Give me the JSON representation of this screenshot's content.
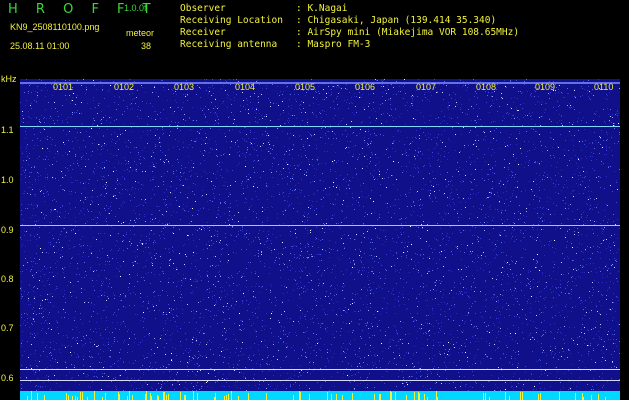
{
  "header": {
    "app_title": "H R O F F T",
    "version": "1.0.0f",
    "filename": "KN9_2508110100.png",
    "datetime": "25.08.11 01:00",
    "meteor_label": "meteor",
    "meteor_count": "38"
  },
  "info": {
    "rows": [
      {
        "label": "Observer",
        "value": ": K.Nagai"
      },
      {
        "label": "Receiving Location",
        "value": ": Chigasaki, Japan (139.414 35.340)"
      },
      {
        "label": "Receiver",
        "value": ": AirSpy mini (Miakejima VOR 108.65MHz)"
      },
      {
        "label": "Receiving antenna",
        "value": ": Maspro FM-3"
      }
    ]
  },
  "spectrogram": {
    "unit": "kHz",
    "y_ticks": [
      "1.1",
      "1.0",
      "0.9",
      "0.8",
      "0.7",
      "0.6"
    ],
    "x_ticks": [
      "0101",
      "0102",
      "0103",
      "0104",
      "0105",
      "0106",
      "0107",
      "0108",
      "0109",
      "0110"
    ],
    "colors": {
      "background": "#10108a",
      "label": "#f2f23a",
      "noise_strong": "#ffffff",
      "carrier": "#7fd8ff",
      "baseline": "#00d8ff"
    }
  }
}
